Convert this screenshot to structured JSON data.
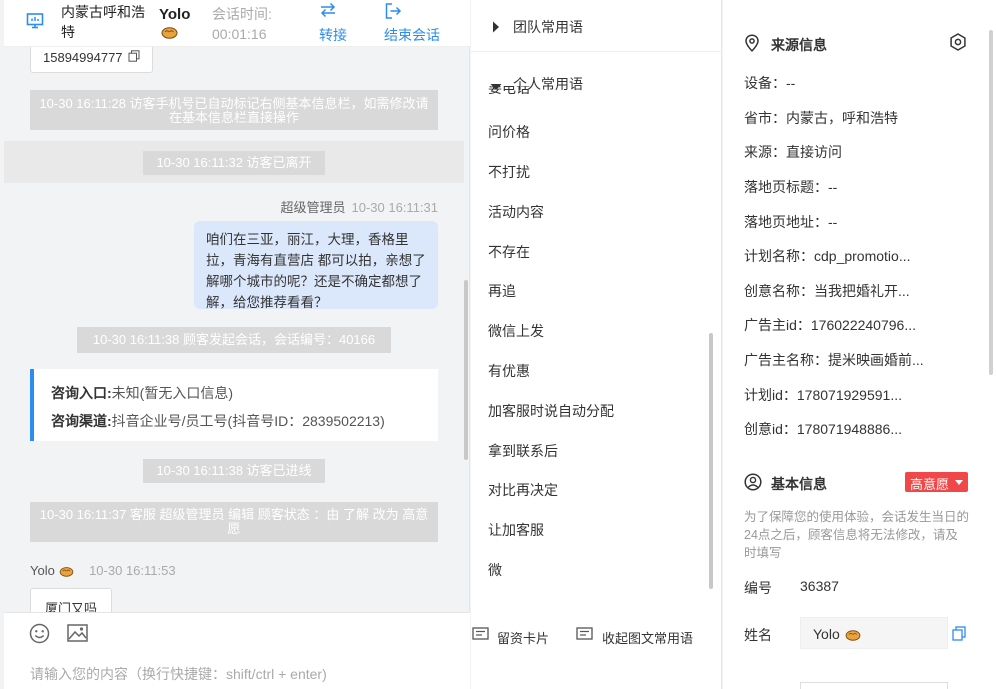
{
  "header": {
    "location": "内蒙古呼和浩特",
    "visitor_name": "Yolo",
    "session_time_label": "会话时间:",
    "session_time_value": "00:01:16",
    "transfer_label": "转接",
    "end_session_label": "结束会话"
  },
  "chat": {
    "phone": "15894994777",
    "messages": [
      {
        "type": "system",
        "text": "10-30 16:11:28 访客手机号已自动标记右侧基本信息栏，如需修改请在基本信息栏直接操作"
      },
      {
        "type": "system",
        "text": "10-30 16:11:32 访客已离开"
      },
      {
        "type": "agent_meta",
        "sender": "超级管理员",
        "time": "10-30 16:11:31"
      },
      {
        "type": "agent",
        "text": "咱们在三亚，丽江，大理，香格里拉，青海有直营店 都可以拍，亲想了解哪个城市的呢？还是不确定都想了解，给您推荐看看？"
      },
      {
        "type": "system",
        "text": "10-30 16:11:38 顾客发起会话，会话编号：40166"
      },
      {
        "type": "system",
        "text": "10-30 16:11:38 访客已进线"
      },
      {
        "type": "system",
        "text": "10-30 16:11:37 客服 超级管理员 编辑 顾客状态 ：由 了解 改为 高意愿"
      }
    ],
    "consult": {
      "entry_label": "咨询入口:",
      "entry_value": "未知(暂无入口信息)",
      "channel_label": "咨询渠道:",
      "channel_value": "抖音企业号/员工号(抖音号ID：2839502213)"
    },
    "visitor_msg": {
      "sender": "Yolo",
      "time": "10-30 16:11:53",
      "text": "厦门又吗"
    },
    "input_placeholder": "请输入您的内容（换行快捷键：shift/ctrl + enter)"
  },
  "phrases": {
    "team_group_label": "团队常用语",
    "personal_group_label": "个人常用语",
    "cut_off_item": "要电话",
    "items": [
      "问价格",
      "不打扰",
      "活动内容",
      "不存在",
      "再追",
      "微信上发",
      "有优惠",
      "加客服时说自动分配",
      "拿到联系后",
      "对比再决定",
      "让加客服",
      "微"
    ],
    "leave_card_label": "留资卡片",
    "collapse_label": "收起图文常用语"
  },
  "info": {
    "source_title": "来源信息",
    "source_rows": [
      "设备：--",
      "省市：内蒙古，呼和浩特",
      "来源：直接访问",
      "落地页标题：--",
      "落地页地址：--",
      "计划名称：cdp_promotio...",
      "创意名称：当我把婚礼开...",
      "广告主id：176022240796...",
      "广告主名称：提米映画婚前...",
      "计划id：178071929591...",
      "创意id：178071948886..."
    ],
    "basic_title": "基本信息",
    "intent_badge": "高意愿",
    "basic_note": "为了保障您的使用体验，会话发生当日的24点之后，顾客信息将无法修改，请及时填写",
    "number_label": "编号",
    "number_value": "36387",
    "name_label": "姓名",
    "name_value": "Yolo"
  },
  "colors": {
    "accent": "#2d8cf0",
    "badge_red": "#f04848",
    "agent_bubble": "#dbe8fb",
    "system_msg": "#d9d9d9"
  }
}
